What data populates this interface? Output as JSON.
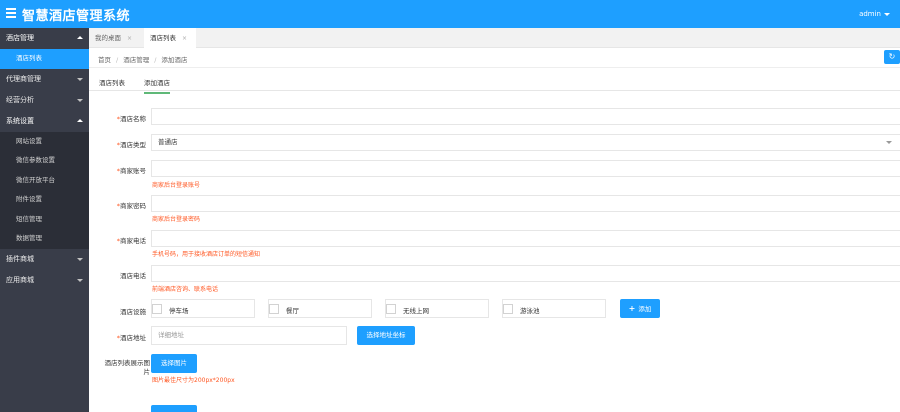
{
  "header": {
    "title": "智慧酒店管理系统",
    "user": "admin"
  },
  "sidebar": {
    "groups": [
      {
        "label": "酒店管理",
        "open": true,
        "items": [
          {
            "label": "酒店列表",
            "active": true
          }
        ]
      },
      {
        "label": "代理商管理",
        "open": false,
        "items": []
      },
      {
        "label": "经营分析",
        "open": false,
        "items": []
      },
      {
        "label": "系统设置",
        "open": true,
        "items": [
          {
            "label": "网站设置"
          },
          {
            "label": "微信参数设置"
          },
          {
            "label": "微信开放平台"
          },
          {
            "label": "附件设置"
          },
          {
            "label": "短信管理"
          },
          {
            "label": "数据管理"
          }
        ]
      },
      {
        "label": "插件商城",
        "open": false,
        "items": []
      },
      {
        "label": "应用商城",
        "open": false,
        "items": []
      }
    ]
  },
  "tabs": [
    {
      "label": "我的桌面",
      "close": "×"
    },
    {
      "label": "酒店列表",
      "close": "×"
    }
  ],
  "breadcrumb": {
    "items": [
      "首页",
      "酒店管理",
      "添加酒店"
    ],
    "sep": "/"
  },
  "refresh_icon": "↻",
  "inner_tabs": [
    "酒店列表",
    "添加酒店"
  ],
  "form": {
    "req": "*",
    "name_label": "酒店名称",
    "type_label": "酒店类型",
    "type_value": "普通店",
    "account_label": "商家账号",
    "account_hint": "商家后台登录账号",
    "password_label": "商家密码",
    "password_hint": "商家后台登录密码",
    "phone_label": "商家电话",
    "phone_hint": "手机号码，用于接收酒店订单的短信通知",
    "tel_label": "酒店电话",
    "tel_hint": "前端酒店咨询、联系电话",
    "facilities_label": "酒店设施",
    "facilities": [
      "停车场",
      "餐厅",
      "无线上网",
      "游泳池"
    ],
    "add_button": "添加",
    "address_label": "酒店地址",
    "address_placeholder": "详细地址",
    "address_button": "选择地址坐标",
    "cover_label": "酒店列表展示图片",
    "cover_button": "选择图片",
    "cover_hint": "图片最佳尺寸为200px*200px"
  }
}
